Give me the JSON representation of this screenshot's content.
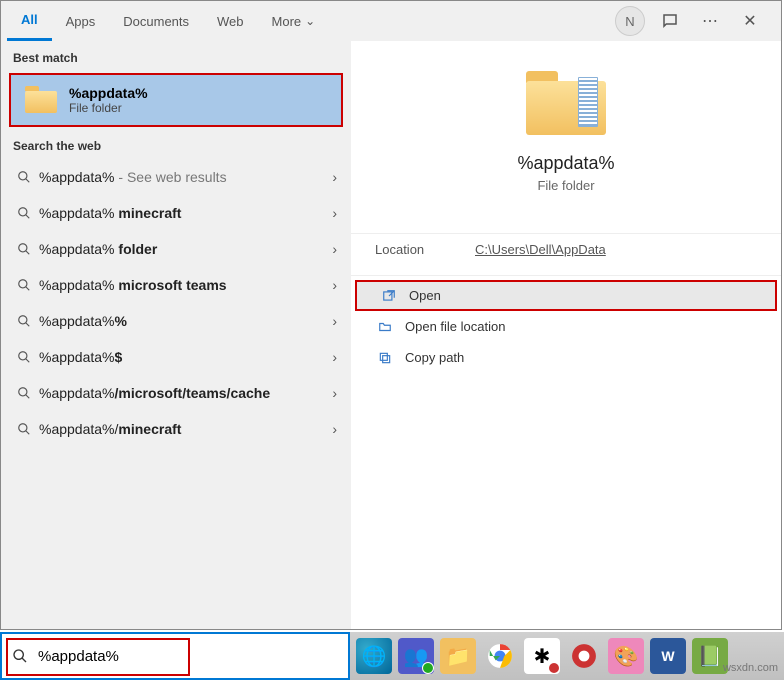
{
  "tabs": {
    "all": "All",
    "apps": "Apps",
    "documents": "Documents",
    "web": "Web",
    "more": "More"
  },
  "avatar": "N",
  "left": {
    "best_match_label": "Best match",
    "best_match": {
      "title": "%appdata%",
      "subtitle": "File folder"
    },
    "search_web_label": "Search the web",
    "items": [
      {
        "prefix": "%appdata%",
        "bold": "",
        "suffix": " - See web results"
      },
      {
        "prefix": "%appdata%",
        "bold": " minecraft",
        "suffix": ""
      },
      {
        "prefix": "%appdata%",
        "bold": " folder",
        "suffix": ""
      },
      {
        "prefix": "%appdata%",
        "bold": " microsoft teams",
        "suffix": ""
      },
      {
        "prefix": "%appdata%",
        "bold": "%",
        "suffix": ""
      },
      {
        "prefix": "%appdata%",
        "bold": "$",
        "suffix": ""
      },
      {
        "prefix": "%appdata%",
        "bold": "/microsoft/teams/cache",
        "suffix": ""
      },
      {
        "prefix": "%appdata%/",
        "bold": "minecraft",
        "suffix": ""
      }
    ]
  },
  "right": {
    "title": "%appdata%",
    "subtitle": "File folder",
    "location_label": "Location",
    "location_value": "C:\\Users\\Dell\\AppData",
    "actions": {
      "open": "Open",
      "open_location": "Open file location",
      "copy_path": "Copy path"
    }
  },
  "search": {
    "value": "%appdata%"
  },
  "watermark": "wsxdn.com"
}
